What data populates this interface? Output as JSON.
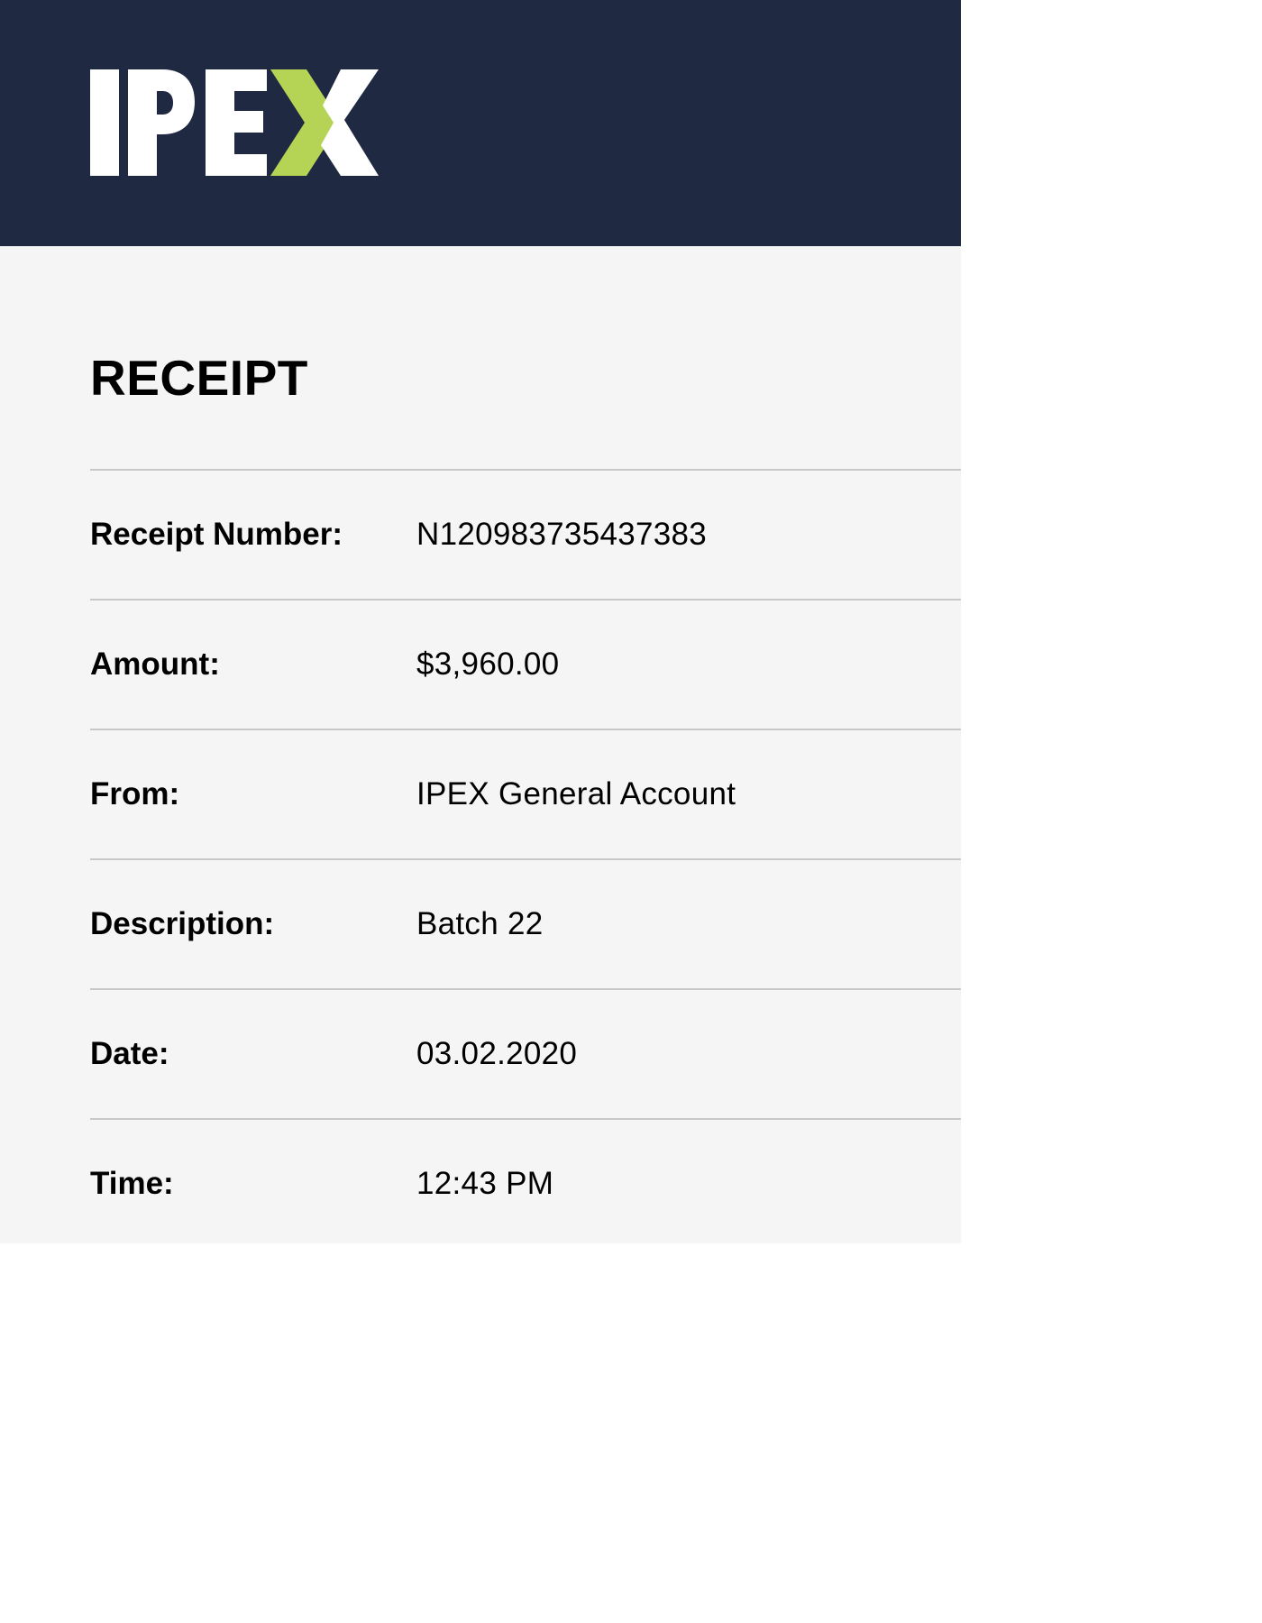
{
  "brand": {
    "logo_text": "IPEX",
    "accent_color": "#b5d455",
    "header_color": "#1f2942"
  },
  "receipt": {
    "title": "RECEIPT",
    "rows": [
      {
        "label": "Receipt Number:",
        "value": "N120983735437383"
      },
      {
        "label": "Amount:",
        "value": "$3,960.00"
      },
      {
        "label": "From:",
        "value": "IPEX General Account"
      },
      {
        "label": "Description:",
        "value": "Batch 22"
      },
      {
        "label": "Date:",
        "value": "03.02.2020"
      },
      {
        "label": "Time:",
        "value": "12:43 PM"
      }
    ]
  }
}
